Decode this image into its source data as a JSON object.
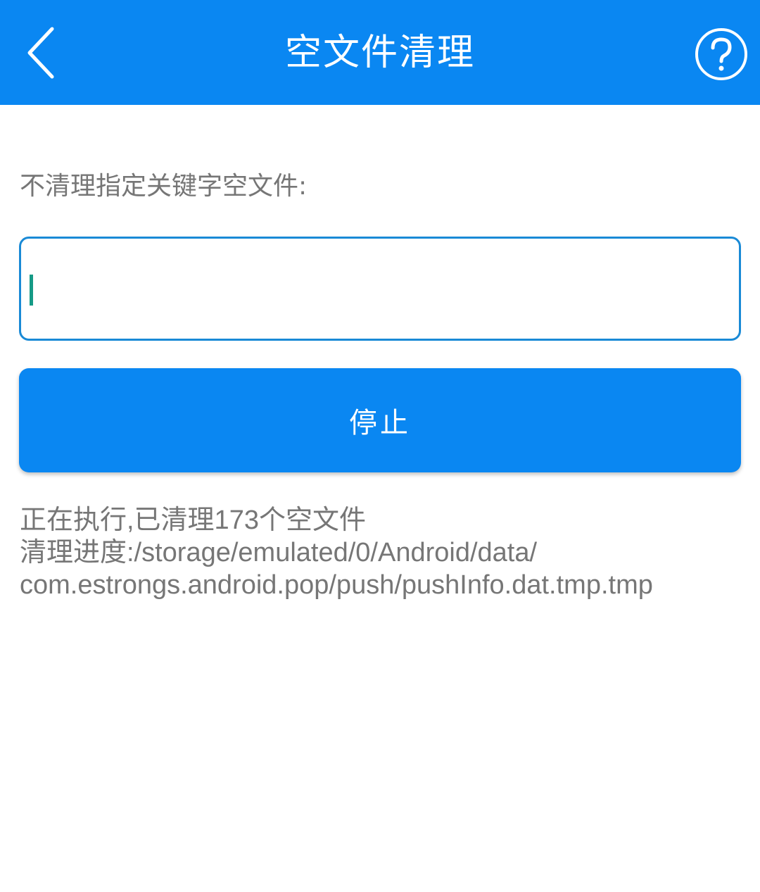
{
  "header": {
    "title": "空文件清理",
    "back_icon": "chevron-left-icon",
    "help_icon": "question-circle-icon",
    "background_color": "#0a87f2"
  },
  "filter": {
    "label": "不清理指定关键字空文件:",
    "input_value": "",
    "input_placeholder": "",
    "border_color": "#1a8ad6"
  },
  "actions": {
    "stop_label": "停止",
    "button_color": "#0a87f2"
  },
  "status": {
    "line1": "正在执行,已清理173个空文件",
    "line2": "清理进度:/storage/emulated/0/Android/data/",
    "line3": "com.estrongs.android.pop/push/pushInfo.dat.tmp.tmp",
    "text_color": "#767676"
  }
}
